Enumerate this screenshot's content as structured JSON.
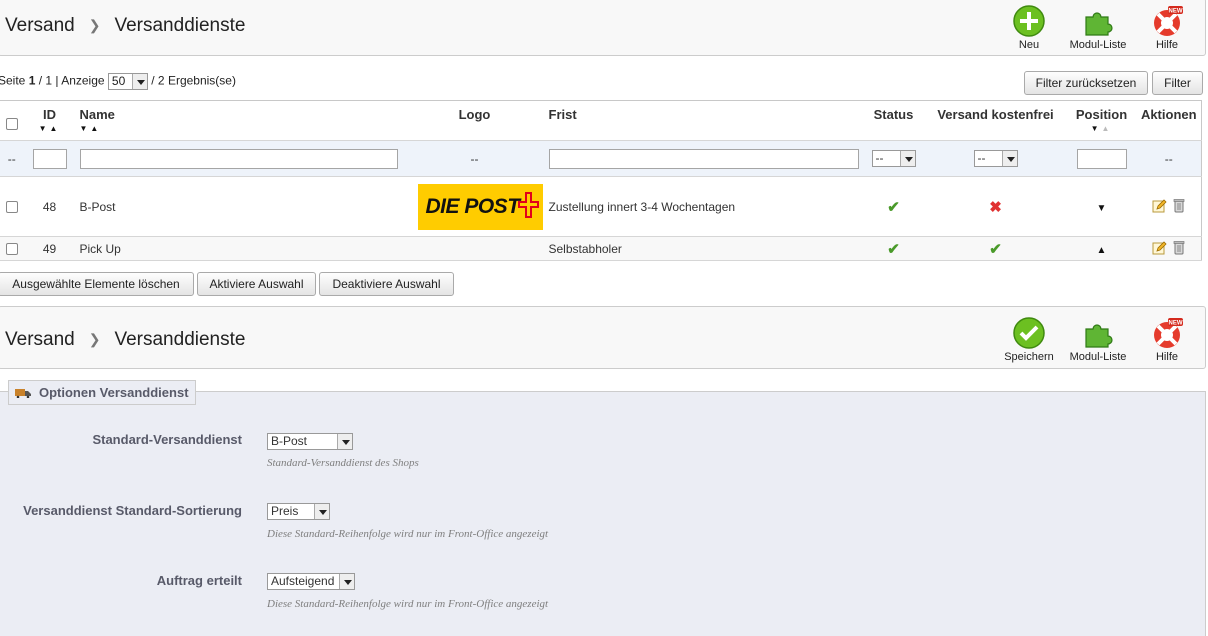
{
  "top_toolbar": {
    "breadcrumb": [
      "Versand",
      "Versanddienste"
    ],
    "buttons": [
      {
        "label": "Neu",
        "icon": "add-icon"
      },
      {
        "label": "Modul-Liste",
        "icon": "puzzle-icon"
      },
      {
        "label": "Hilfe",
        "icon": "lifebuoy-icon"
      }
    ]
  },
  "pager": {
    "prefix": "Seite",
    "page": "1",
    "of": "/ 1 | Anzeige",
    "per_page": "50",
    "results": "/ 2 Ergebnis(se)"
  },
  "filter_buttons": {
    "reset": "Filter zurücksetzen",
    "filter": "Filter"
  },
  "table": {
    "headers": {
      "id": "ID",
      "name": "Name",
      "logo": "Logo",
      "frist": "Frist",
      "status": "Status",
      "free": "Versand kostenfrei",
      "position": "Position",
      "actions": "Aktionen"
    },
    "filter_row": {
      "dash": "--",
      "status_value": "--",
      "free_value": "--",
      "logo_dash": "--",
      "actions_dash": "--"
    },
    "rows": [
      {
        "id": "48",
        "name": "B-Post",
        "logo_text": "DIE POST",
        "frist": "Zustellung innert 3-4 Wochentagen",
        "status": "active",
        "free": "no",
        "position": "down"
      },
      {
        "id": "49",
        "name": "Pick Up",
        "logo_text": "",
        "frist": "Selbstabholer",
        "status": "active",
        "free": "yes",
        "position": "up"
      }
    ]
  },
  "bulk_buttons": [
    "Ausgewählte Elemente löschen",
    "Aktiviere Auswahl",
    "Deaktiviere Auswahl"
  ],
  "bottom_toolbar": {
    "breadcrumb": [
      "Versand",
      "Versanddienste"
    ],
    "buttons": [
      {
        "label": "Speichern",
        "icon": "save-check-icon"
      },
      {
        "label": "Modul-Liste",
        "icon": "puzzle-icon"
      },
      {
        "label": "Hilfe",
        "icon": "lifebuoy-icon"
      }
    ]
  },
  "options": {
    "legend": "Optionen Versanddienst",
    "fields": [
      {
        "label": "Standard-Versanddienst",
        "value": "B-Post",
        "hint": "Standard-Versanddienst des Shops"
      },
      {
        "label": "Versanddienst Standard-Sortierung",
        "value": "Preis",
        "hint": "Diese Standard-Reihenfolge wird nur im Front-Office angezeigt"
      },
      {
        "label": "Auftrag erteilt",
        "value": "Aufsteigend",
        "hint": "Diese Standard-Reihenfolge wird nur im Front-Office angezeigt"
      }
    ]
  },
  "colors": {
    "check": "#4a9a2a",
    "cross": "#e03030",
    "logo_bg": "#ffcc00",
    "panel_bg": "#ebedf4"
  }
}
